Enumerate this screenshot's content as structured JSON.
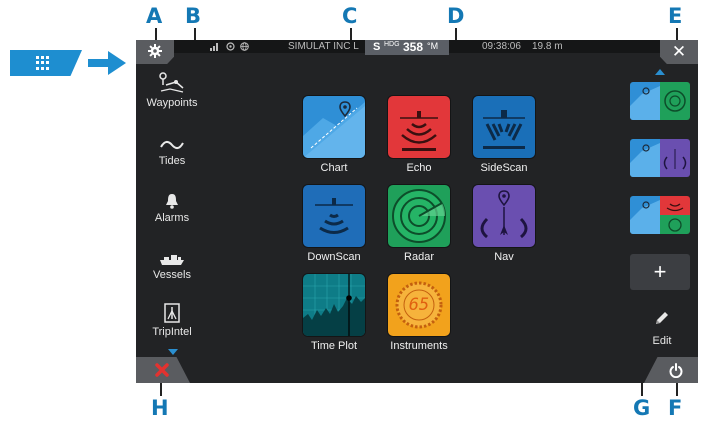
{
  "callouts": {
    "a": "A",
    "b": "B",
    "c": "C",
    "d": "D",
    "e": "E",
    "f": "F",
    "g": "G",
    "h": "H"
  },
  "status": {
    "source": "SIMULAT INC L",
    "hdg_prefix": "S",
    "hdg_label": "HDG",
    "hdg_value": "358",
    "hdg_unit": "°M",
    "time": "09:38:06",
    "depth": "19.8 m"
  },
  "topbar": {
    "close_glyph": "✕"
  },
  "sidebar": {
    "items": [
      {
        "label": "Waypoints",
        "icon": "waypoints-icon"
      },
      {
        "label": "Tides",
        "icon": "tides-icon"
      },
      {
        "label": "Alarms",
        "icon": "alarm-bell-icon"
      },
      {
        "label": "Vessels",
        "icon": "vessels-icon"
      },
      {
        "label": "TripIntel",
        "icon": "tripintel-icon"
      }
    ]
  },
  "apps": [
    {
      "label": "Chart",
      "color": "#2f8fd6"
    },
    {
      "label": "Echo",
      "color": "#e2373a"
    },
    {
      "label": "SideScan",
      "color": "#1a6fb8"
    },
    {
      "label": "DownScan",
      "color": "#1f6db8"
    },
    {
      "label": "Radar",
      "color": "#1fa05a"
    },
    {
      "label": "Nav",
      "color": "#6a4fb0"
    },
    {
      "label": "Time Plot",
      "color": "#0e7c87"
    },
    {
      "label": "Instruments",
      "color": "#f2a21c"
    }
  ],
  "instruments_readout": "65",
  "favorites": {
    "items": [
      {
        "name": "chart-radar",
        "colors": [
          "#2f8fd6",
          "#1fa05a"
        ]
      },
      {
        "name": "chart-nav",
        "colors": [
          "#2f8fd6",
          "#6a4fb0"
        ]
      },
      {
        "name": "chart-echo-radar",
        "colors": [
          "#2f8fd6",
          "#e2373a",
          "#1fa05a"
        ]
      }
    ],
    "add_glyph": "+",
    "edit_label": "Edit"
  },
  "colors": {
    "accent": "#1478b4",
    "menu_button": "#1e8ed0",
    "screen_bg": "#222325"
  }
}
